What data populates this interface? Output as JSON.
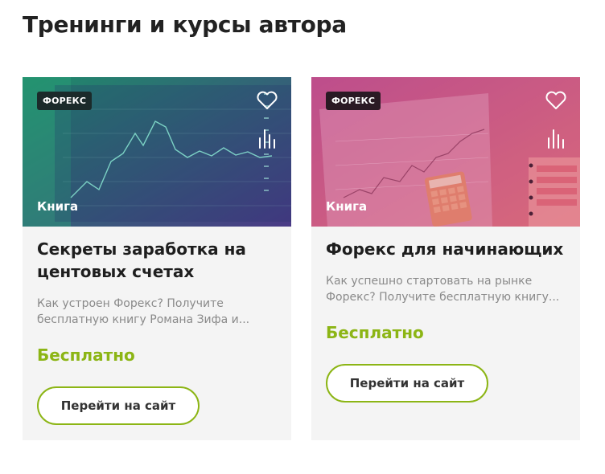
{
  "section": {
    "title": "Тренинги и курсы автора"
  },
  "cards": [
    {
      "badge": "ФОРЕКС",
      "type": "Книга",
      "title": "Секреты заработка на центовых счетах",
      "description": "Как устроен Форекс? Получите бесплатную книгу Романа Зифа и...",
      "price": "Бесплатно",
      "button": "Перейти на сайт",
      "icons": [
        "heart-icon",
        "stats-icon"
      ],
      "image_tint": [
        "#1e8a6a",
        "#4a3a86"
      ]
    },
    {
      "badge": "ФОРЕКС",
      "type": "Книга",
      "title": "Форекс для начинающих",
      "description": "Как успешно стартовать на рынке Форекс? Получите бесплатную книгу...",
      "price": "Бесплатно",
      "button": "Перейти на сайт",
      "icons": [
        "heart-icon",
        "stats-icon"
      ],
      "image_tint": [
        "#c0508e",
        "#e0707a"
      ]
    }
  ],
  "colors": {
    "accent": "#8cb515",
    "title": "#1e1e1e",
    "muted": "#8a8a8a",
    "card_bg": "#f4f4f4"
  }
}
